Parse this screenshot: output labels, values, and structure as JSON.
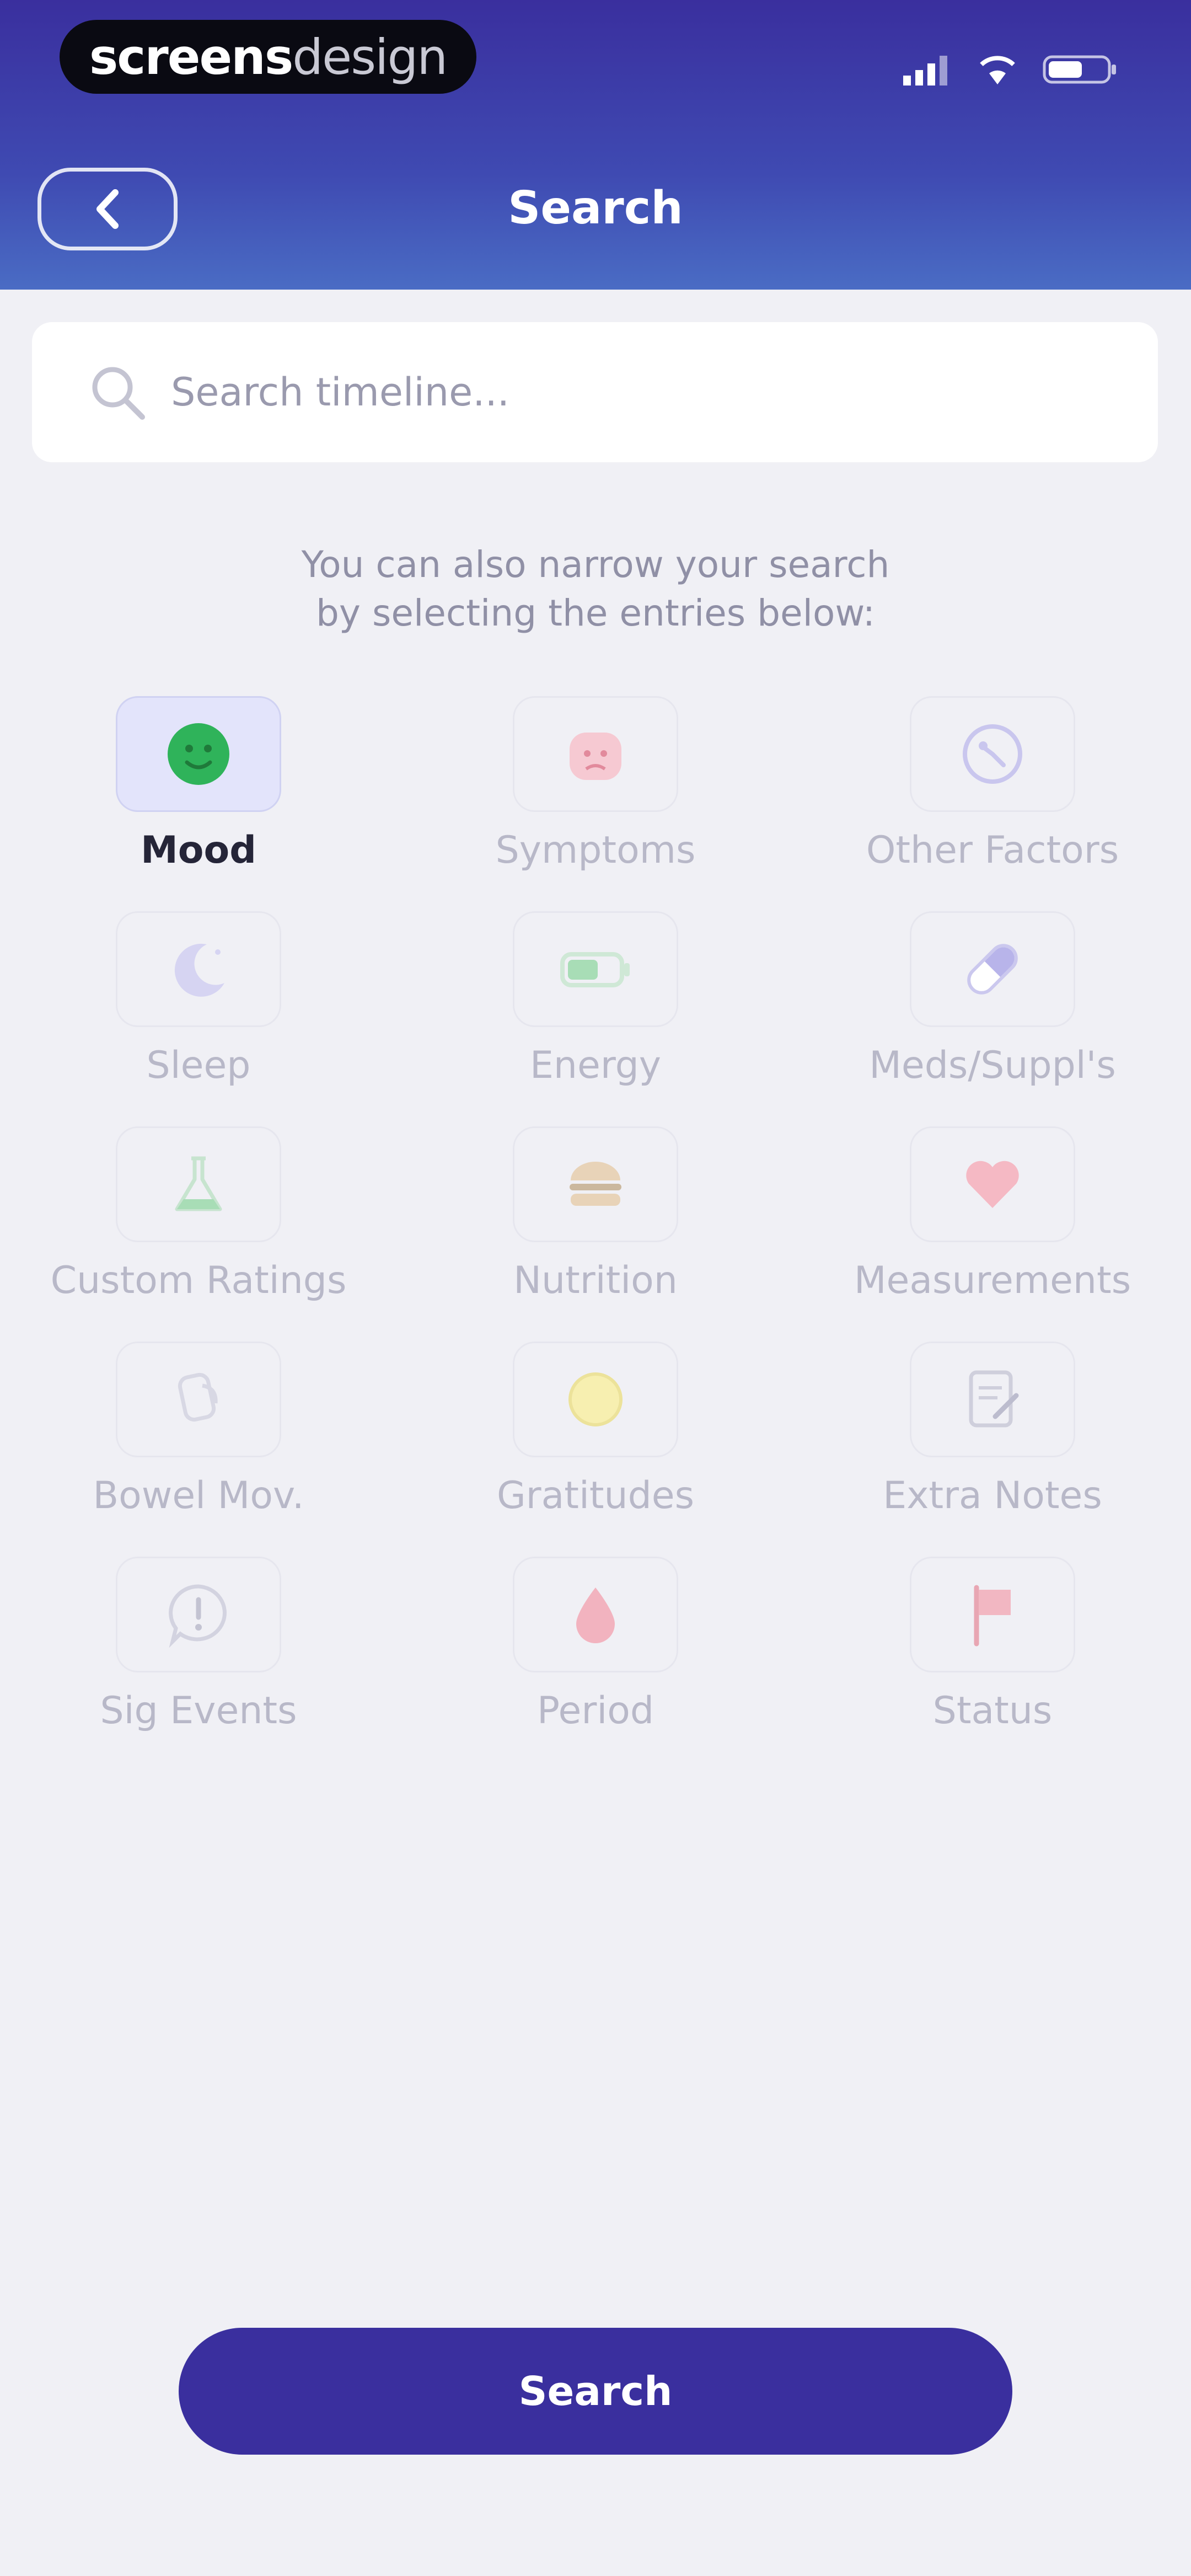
{
  "brand": {
    "part1": "screens",
    "part2": "design"
  },
  "header": {
    "title": "Search"
  },
  "search": {
    "placeholder": "Search timeline..."
  },
  "hint": {
    "line1": "You can also narrow your search",
    "line2": "by selecting the entries below:"
  },
  "categories": [
    {
      "label": "Mood",
      "icon": "mood-face-icon",
      "selected": true
    },
    {
      "label": "Symptoms",
      "icon": "symptoms-icon",
      "selected": false
    },
    {
      "label": "Other Factors",
      "icon": "other-factors-icon",
      "selected": false
    },
    {
      "label": "Sleep",
      "icon": "moon-icon",
      "selected": false
    },
    {
      "label": "Energy",
      "icon": "battery-icon",
      "selected": false
    },
    {
      "label": "Meds/Suppl's",
      "icon": "pill-icon",
      "selected": false
    },
    {
      "label": "Custom Ratings",
      "icon": "flask-icon",
      "selected": false
    },
    {
      "label": "Nutrition",
      "icon": "burger-icon",
      "selected": false
    },
    {
      "label": "Measurements",
      "icon": "heart-icon",
      "selected": false
    },
    {
      "label": "Bowel Mov.",
      "icon": "bowel-icon",
      "selected": false
    },
    {
      "label": "Gratitudes",
      "icon": "sun-icon",
      "selected": false
    },
    {
      "label": "Extra Notes",
      "icon": "note-icon",
      "selected": false
    },
    {
      "label": "Sig Events",
      "icon": "alert-icon",
      "selected": false
    },
    {
      "label": "Period",
      "icon": "drop-icon",
      "selected": false
    },
    {
      "label": "Status",
      "icon": "flag-icon",
      "selected": false
    }
  ],
  "actions": {
    "search_button": "Search"
  },
  "colors": {
    "accent": "#3a2f9e",
    "background": "#f0f0f5"
  }
}
